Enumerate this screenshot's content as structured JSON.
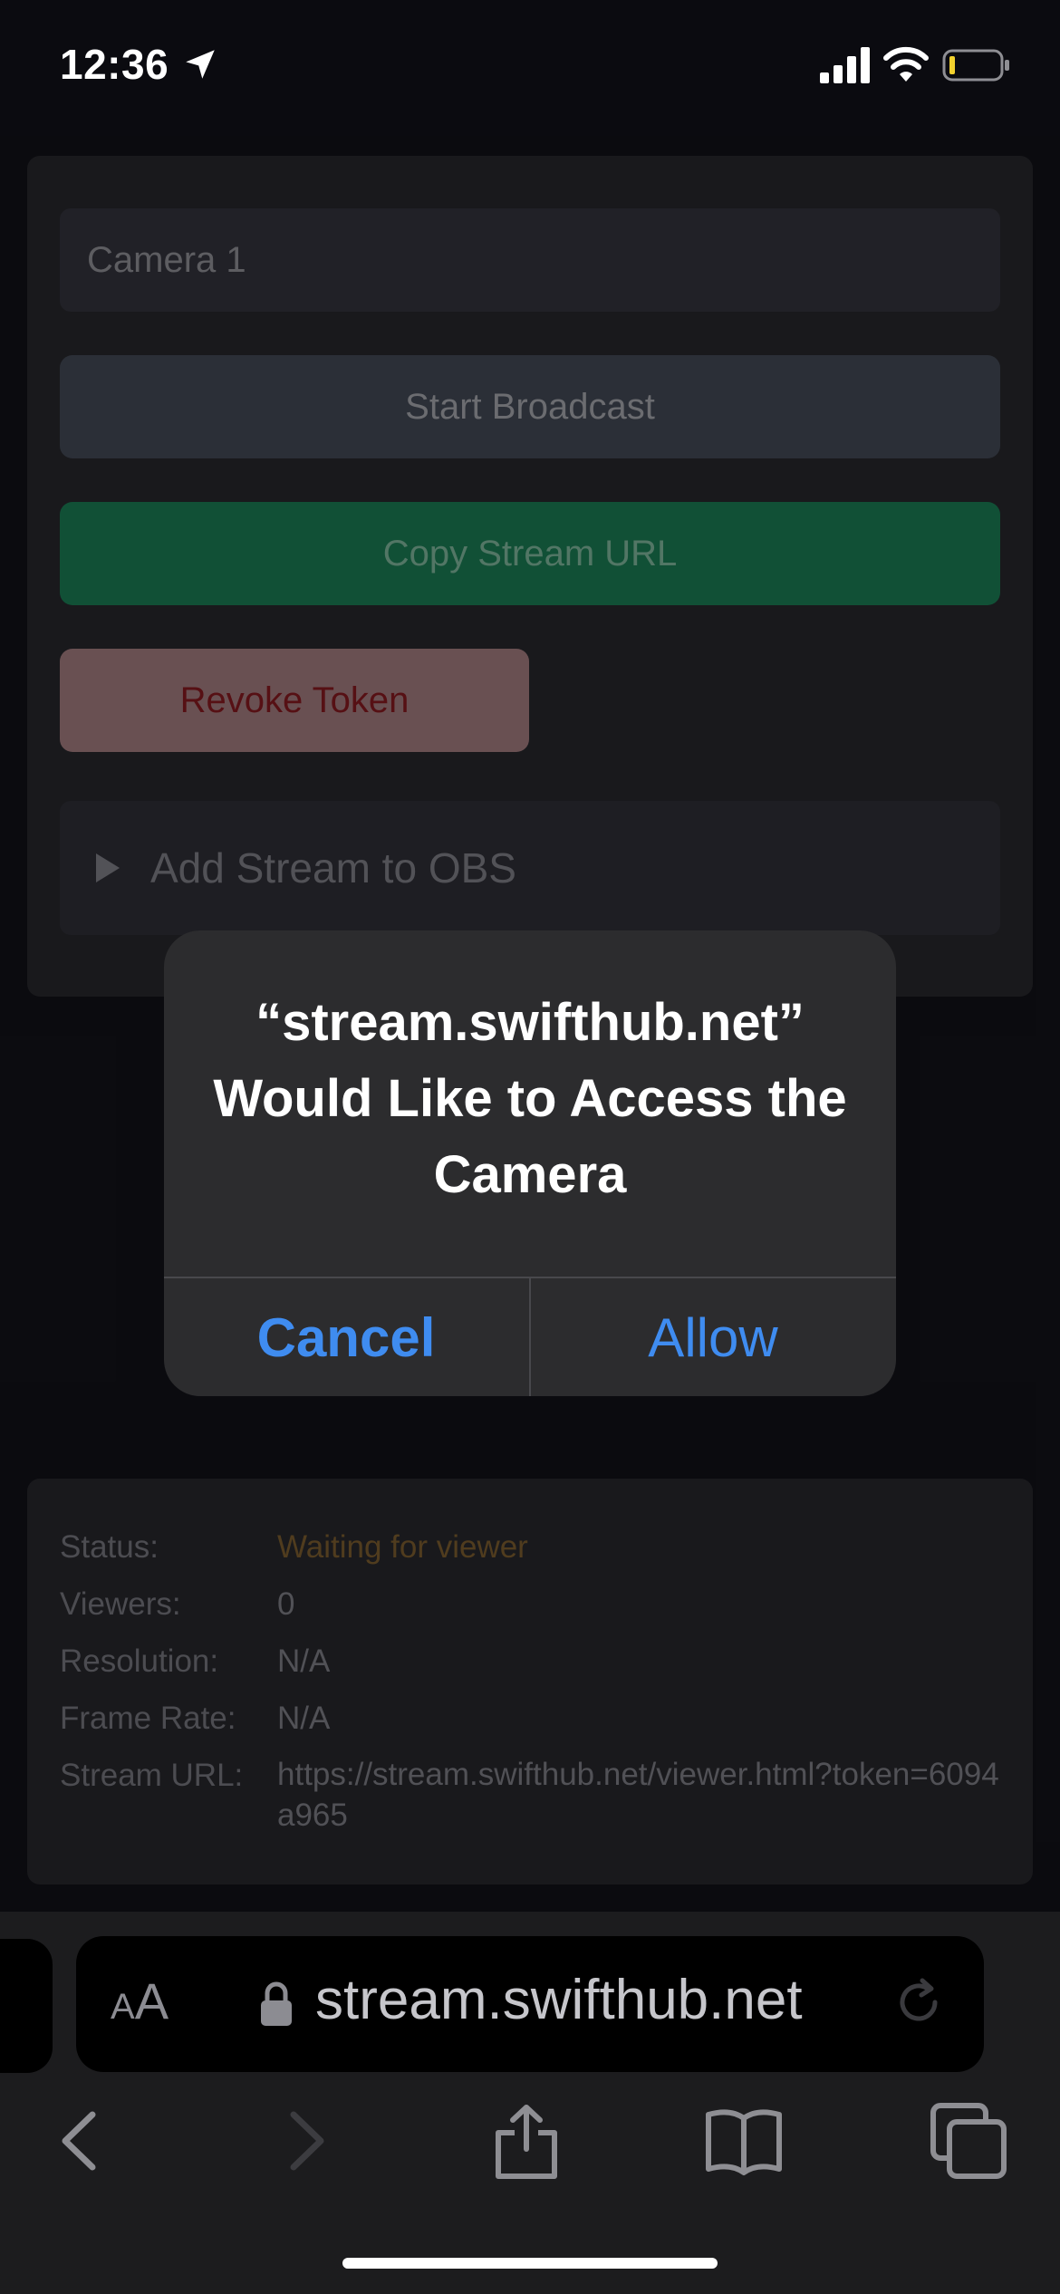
{
  "status_bar": {
    "time": "12:36",
    "icons": [
      "location-arrow-icon",
      "cellular-signal-icon",
      "wifi-icon",
      "battery-icon"
    ],
    "battery_color": "#f2d12e"
  },
  "form": {
    "camera_name_value": "Camera 1",
    "start_broadcast_label": "Start Broadcast",
    "copy_stream_url_label": "Copy Stream URL",
    "revoke_token_label": "Revoke Token",
    "add_stream_obs_label": "Add Stream to OBS"
  },
  "stream_status": {
    "status_label": "Status:",
    "status_value": "Waiting for viewer",
    "viewers_label": "Viewers:",
    "viewers_value": "0",
    "resolution_label": "Resolution:",
    "resolution_value": "N/A",
    "frame_rate_label": "Frame Rate:",
    "frame_rate_value": "N/A",
    "stream_url_label": "Stream URL:",
    "stream_url_value": "https://stream.swifthub.net/viewer.html?token=6094a965"
  },
  "alert": {
    "title": "“stream.swifthub.net” Would Like to Access the Camera",
    "cancel_label": "Cancel",
    "allow_label": "Allow",
    "button_color": "#3f8cf0"
  },
  "browser": {
    "aa_big": "A",
    "aa_small": "A",
    "url": "stream.swifthub.net",
    "toolbar_icons": [
      "back-icon",
      "forward-icon",
      "share-icon",
      "bookmarks-icon",
      "tabs-icon"
    ]
  },
  "colors": {
    "copy_button": "#1e8a5e",
    "revoke_button": "#b58a8e",
    "revoke_text": "#951d23",
    "waiting_status": "#8a6834"
  }
}
